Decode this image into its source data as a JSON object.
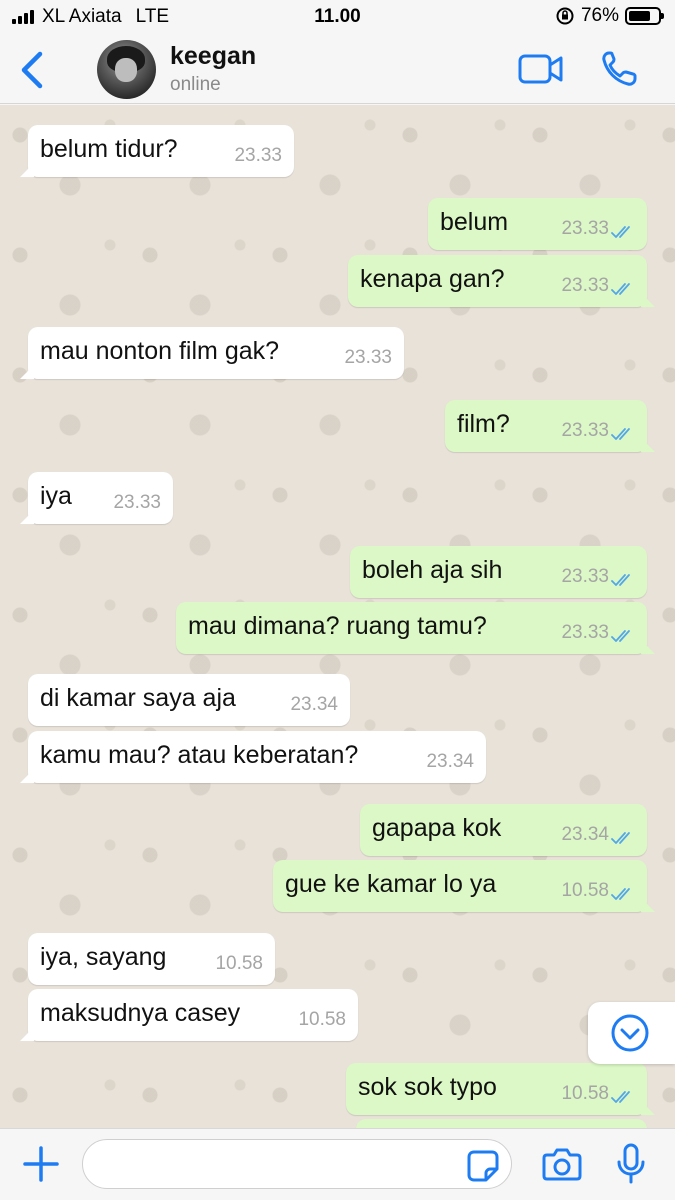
{
  "status_bar": {
    "carrier": "XL Axiata",
    "network": "LTE",
    "time": "11.00",
    "battery_percent": "76%",
    "battery_level": 0.76
  },
  "header": {
    "contact_name": "keegan",
    "contact_status": "online",
    "icons": [
      "chevron-left-icon",
      "avatar",
      "video-camera-icon",
      "phone-icon"
    ],
    "accent_color": "#1e7cf2"
  },
  "messages": [
    {
      "dir": "in",
      "text": "belum tidur?",
      "time": "23.33"
    },
    {
      "dir": "out",
      "text": "belum",
      "time": "23.33",
      "read": true
    },
    {
      "dir": "out",
      "text": "kenapa gan?",
      "time": "23.33",
      "read": true
    },
    {
      "dir": "in",
      "text": "mau nonton film gak?",
      "time": "23.33"
    },
    {
      "dir": "out",
      "text": "film?",
      "time": "23.33",
      "read": true
    },
    {
      "dir": "in",
      "text": "iya",
      "time": "23.33"
    },
    {
      "dir": "out",
      "text": "boleh aja sih",
      "time": "23.33",
      "read": true
    },
    {
      "dir": "out",
      "text": "mau dimana? ruang tamu?",
      "time": "23.33",
      "read": true
    },
    {
      "dir": "in",
      "text": "di kamar saya aja",
      "time": "23.34"
    },
    {
      "dir": "in",
      "text": "kamu mau? atau keberatan?",
      "time": "23.34"
    },
    {
      "dir": "out",
      "text": "gapapa kok",
      "time": "23.34",
      "read": true
    },
    {
      "dir": "out",
      "text": "gue ke kamar lo ya",
      "time": "10.58",
      "read": true
    },
    {
      "dir": "in",
      "text": "iya, sayang",
      "time": "10.58"
    },
    {
      "dir": "in",
      "text": "maksudnya casey",
      "time": "10.58"
    },
    {
      "dir": "out",
      "text": "sok sok typo",
      "time": "10.58",
      "read": true
    }
  ],
  "colors": {
    "incoming_bubble": "#ffffff",
    "outgoing_bubble": "#dcf8c6",
    "read_ticks": "#53a6e8",
    "chat_background": "#e8e2d9"
  },
  "composer": {
    "input_value": "",
    "icons": [
      "plus-icon",
      "sticker-icon",
      "camera-icon",
      "microphone-icon"
    ]
  }
}
